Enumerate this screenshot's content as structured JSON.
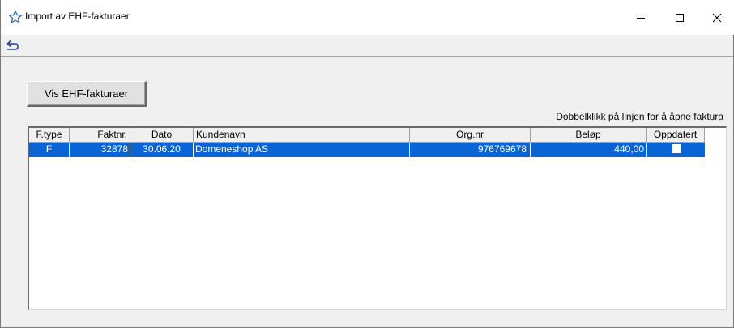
{
  "window": {
    "title": "Import av EHF-fakturaer",
    "controls": [
      "minimize-icon",
      "maximize-icon",
      "close-icon"
    ]
  },
  "toolbar": {
    "back_icon": "return-arrow-icon"
  },
  "main": {
    "button_label": "Vis EHF-fakturaer",
    "hint": "Dobbelklikk på linjen for å åpne faktura"
  },
  "grid": {
    "columns": [
      "F.type",
      "Faktnr.",
      "Dato",
      "Kundenavn",
      "Org.nr",
      "Beløp",
      "Oppdatert"
    ],
    "rows": [
      {
        "ftype": "F",
        "faktnr": "32878",
        "dato": "30.06.20",
        "kundenavn": "Domeneshop AS",
        "orgnr": "976769678",
        "belop": "440,00",
        "oppdatert": false
      }
    ],
    "selection_color": "#0a64d6"
  }
}
